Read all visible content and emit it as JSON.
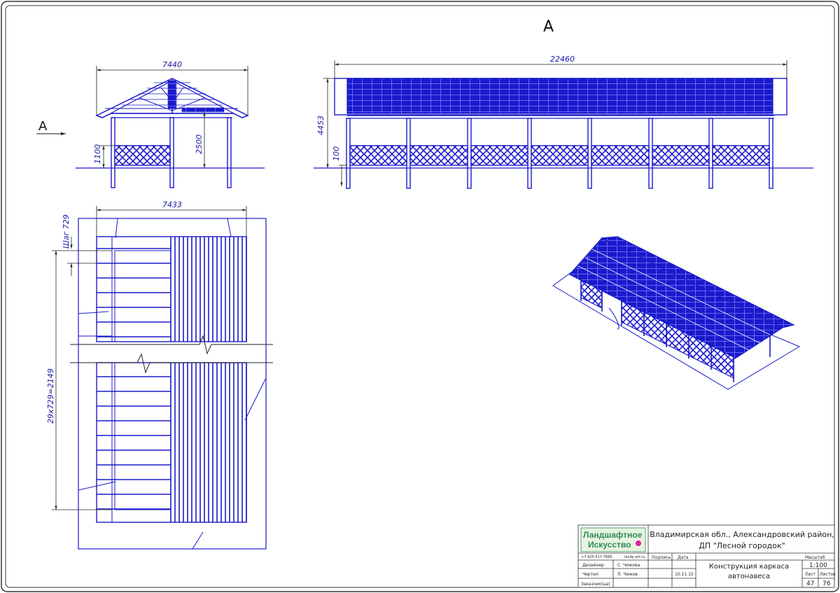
{
  "view_label": "А",
  "section_arrow_label": "А",
  "dimensions": {
    "front_width": "7440",
    "side_length": "22460",
    "plan_width": "7433",
    "post_height": "2500",
    "lattice_height_front": "1100",
    "total_height": "4453",
    "lattice_gap": "100",
    "rafter_step": "Шаг 729",
    "plan_length": "29х729=2149"
  },
  "title_block": {
    "logo_line1": "Ландшафтное",
    "logo_line2": "Искусство",
    "phone": "+7-925-517-7660",
    "website": "landy-art.ru",
    "location_line1": "Владимирская обл., Александровский район,",
    "location_line2": "ДП \"Лесной городок\"",
    "col_signature": "Подпись",
    "col_date": "Дата",
    "scale_label": "Масштаб",
    "scale_value": "1:100",
    "designer_role": "Дизайнер",
    "designer_name": "С. Чижова",
    "drafter_role": "Чертил",
    "drafter_name": "Л. Чижов",
    "client_role": "Заказчик(ца)",
    "date_value": "10.11.15",
    "drawing_title_line1": "Конструкция каркаса",
    "drawing_title_line2": "автонавеса",
    "sheet_label": "Лист",
    "sheets_label": "Листов",
    "sheet_value": "47",
    "sheets_value": "76"
  },
  "colors": {
    "line": "#1a1acc",
    "fill_dense": "#2222cc",
    "logo_green": "#2e8b57",
    "logo_bg": "#e8f3e0",
    "logo_dot": "#e020a0"
  }
}
